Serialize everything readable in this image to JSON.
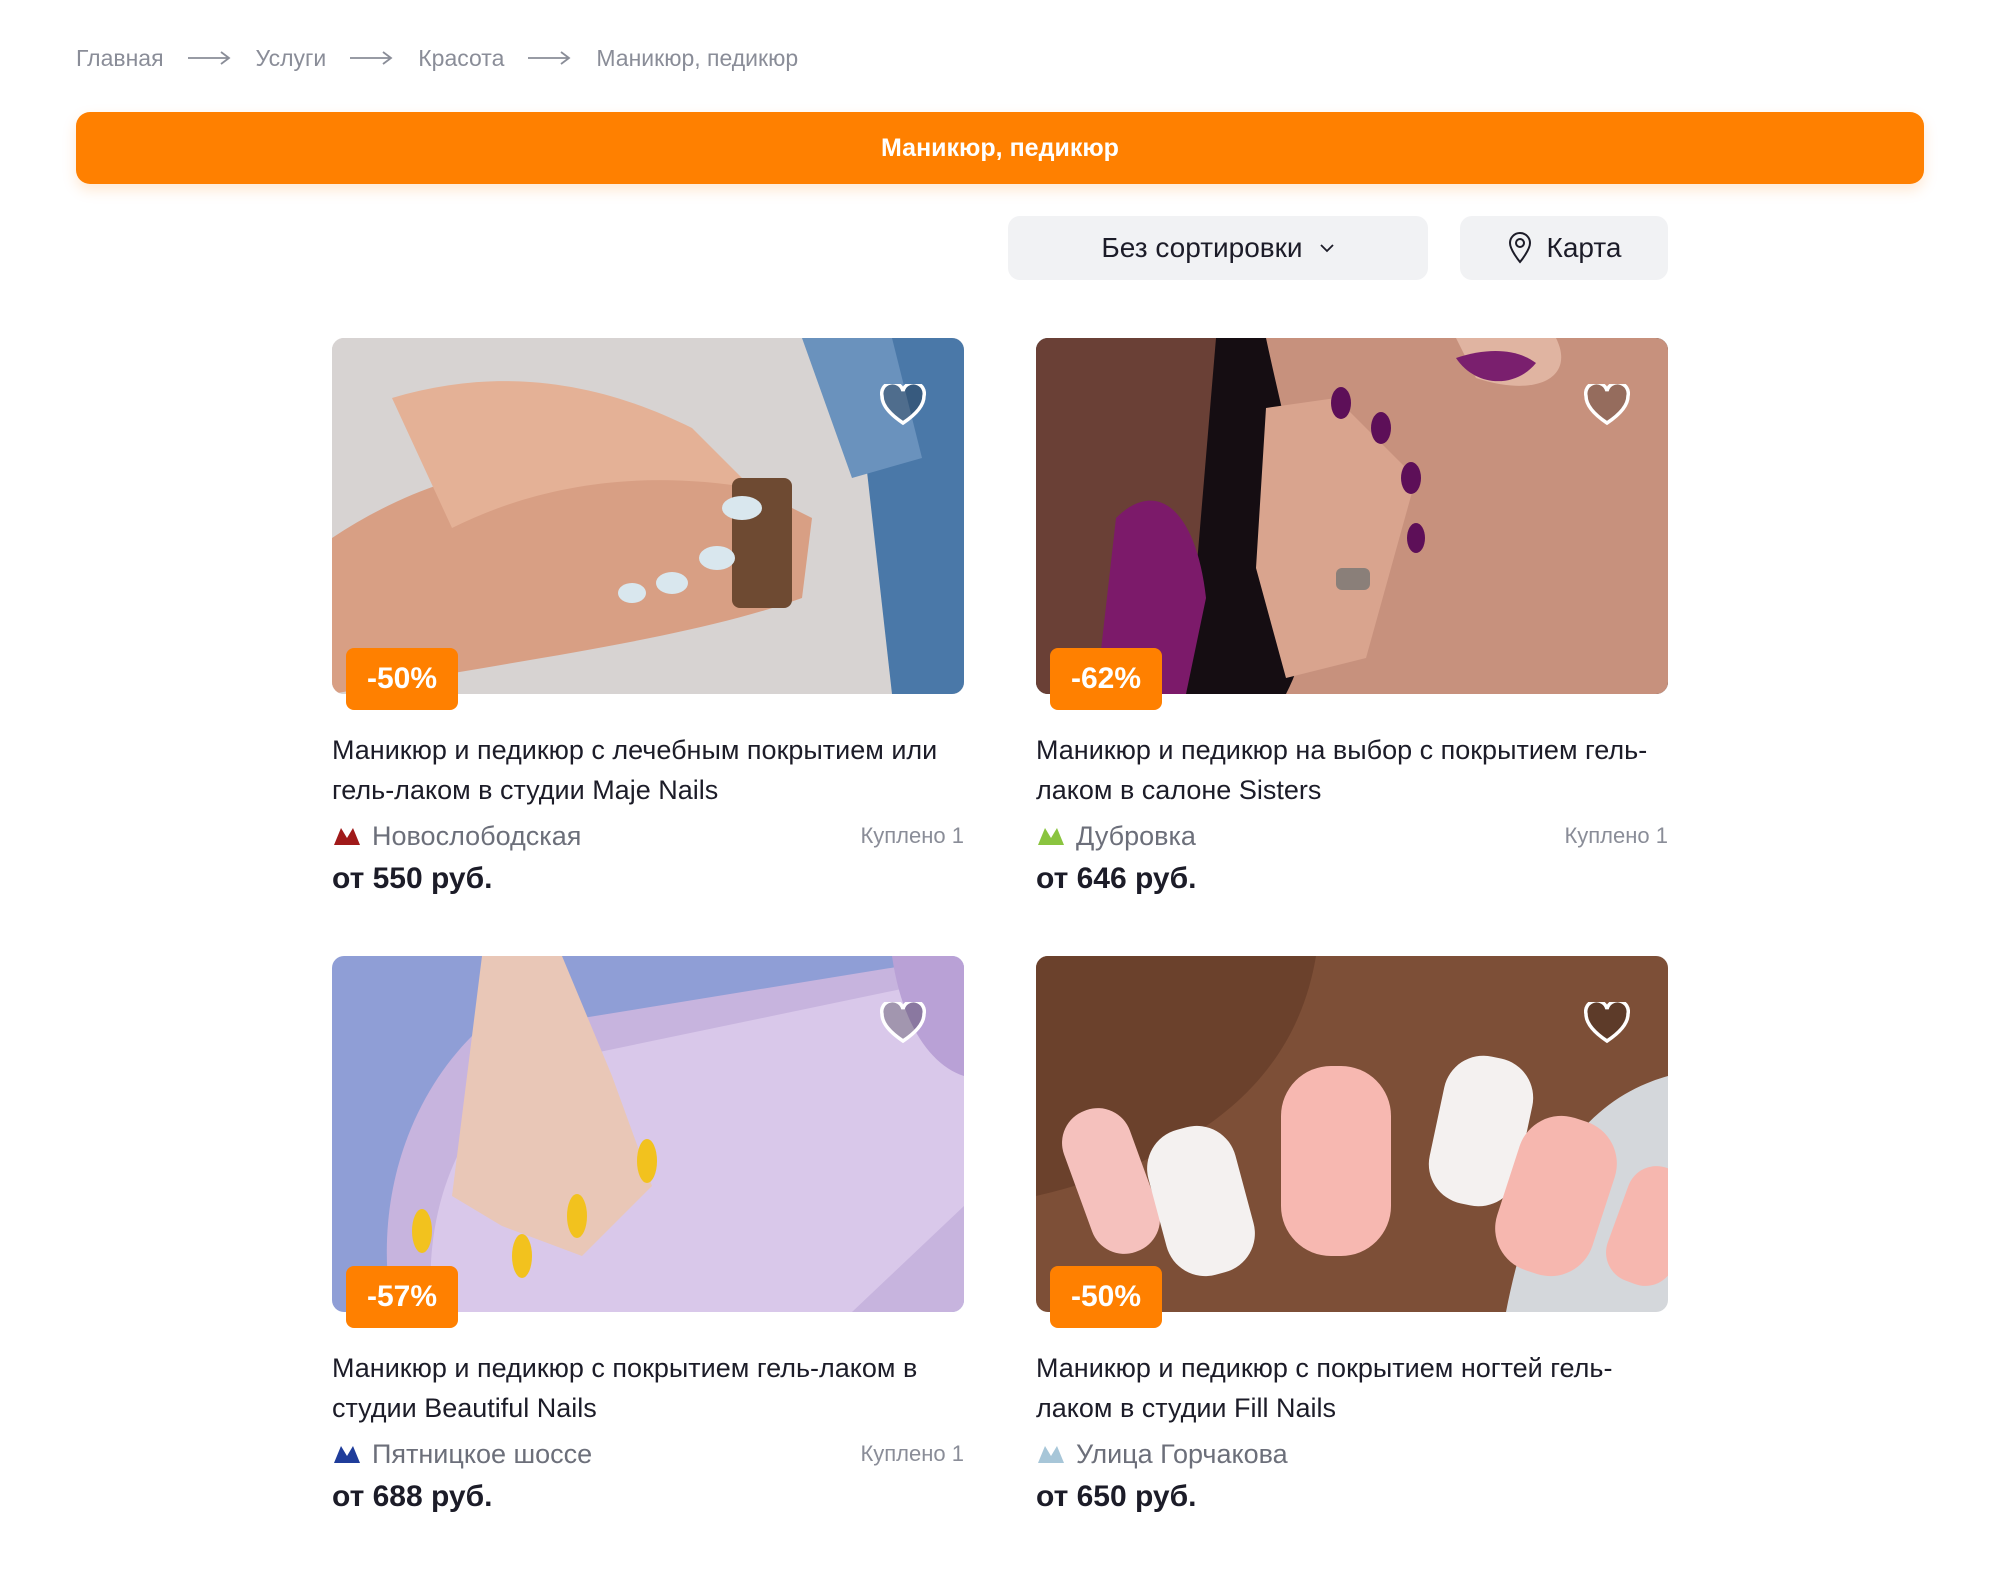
{
  "breadcrumb": [
    "Главная",
    "Услуги",
    "Красота",
    "Маникюр, педикюр"
  ],
  "title": "Маникюр, педикюр",
  "controls": {
    "sort_label": "Без сортировки",
    "map_label": "Карта"
  },
  "colors": {
    "accent": "#ff8000",
    "metro_red": "#a01a1a",
    "metro_green": "#8ac43f",
    "metro_blue": "#1f3c9a",
    "metro_lightblue": "#a7c6d8"
  },
  "cards": [
    {
      "discount": "-50%",
      "title": "Маникюр и педикюр с лечебным покрытием или гель-лаком в студии Maje Nails",
      "metro": "Новослободская",
      "metro_color": "#a01a1a",
      "bought": "Куплено 1",
      "price": "от 550 руб.",
      "photo": "nails-white-with-watch"
    },
    {
      "discount": "-62%",
      "title": "Маникюр и педикюр на выбор с покрытием гель-лаком в салоне Sisters",
      "metro": "Дубровка",
      "metro_color": "#8ac43f",
      "bought": "Куплено 1",
      "price": "от 646 руб.",
      "photo": "purple-nails-woman"
    },
    {
      "discount": "-57%",
      "title": "Маникюр и педикюр с покрытием гель-лаком в студии Beautiful Nails",
      "metro": "Пятницкое шоссе",
      "metro_color": "#1f3c9a",
      "bought": "Куплено 1",
      "price": "от 688 руб.",
      "photo": "yellow-nails-lilac"
    },
    {
      "discount": "-50%",
      "title": "Маникюр и педикюр с покрытием ногтей гель-лаком в студии Fill Nails",
      "metro": "Улица Горчакова",
      "metro_color": "#a7c6d8",
      "bought": "",
      "price": "от 650 руб.",
      "photo": "pink-nails-butterfly"
    }
  ]
}
